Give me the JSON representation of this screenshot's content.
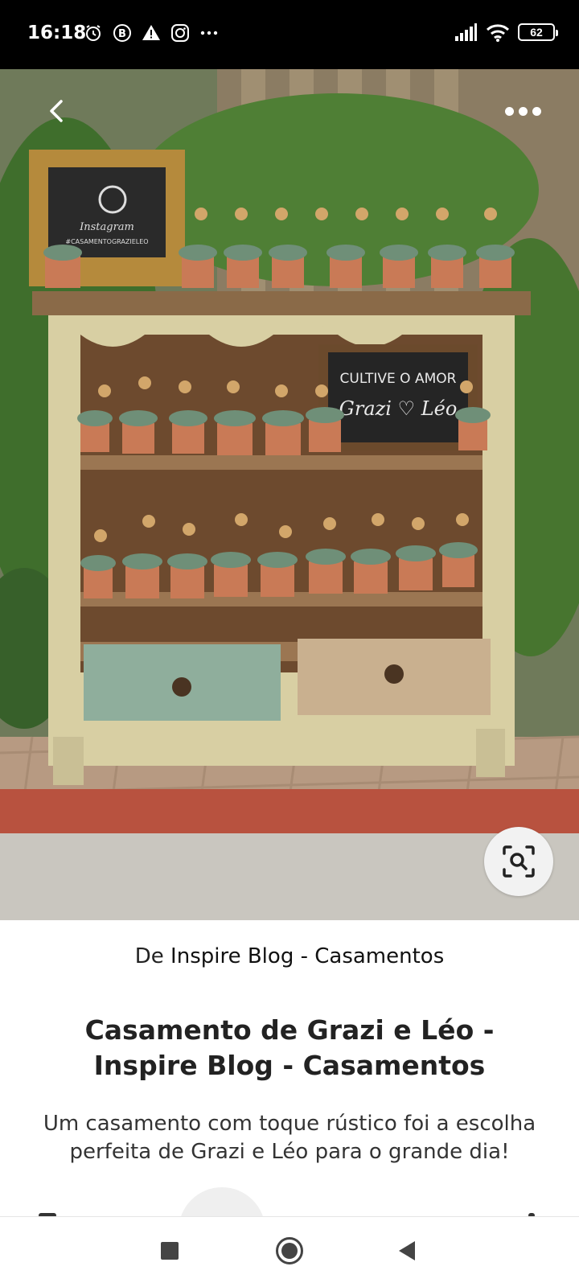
{
  "status_bar": {
    "time": "16:18",
    "left_icons": [
      "alarm-icon",
      "b-badge-icon",
      "warning-icon",
      "instagram-icon",
      "more-dots-icon"
    ],
    "battery": "62"
  },
  "photo": {
    "frame_sign_text": "#CASAMENTOGRAZIELEO",
    "frame_sign_script": "Instagram",
    "chalk_sign_line1": "CULTIVE O AMOR",
    "chalk_sign_line2": "Grazi ♡ Léo"
  },
  "pin": {
    "source_prefix": "De",
    "source_name": "Inspire Blog - Casamentos",
    "title": "Casamento de Grazi e Léo - Inspire Blog - Casamentos",
    "description": "Um casamento com toque rústico foi a escolha perfeita de Grazi e Léo para o grande dia!"
  },
  "colors": {
    "status_bar_bg": "#000000",
    "text_primary": "#222222",
    "nav_icon": "#444444"
  }
}
